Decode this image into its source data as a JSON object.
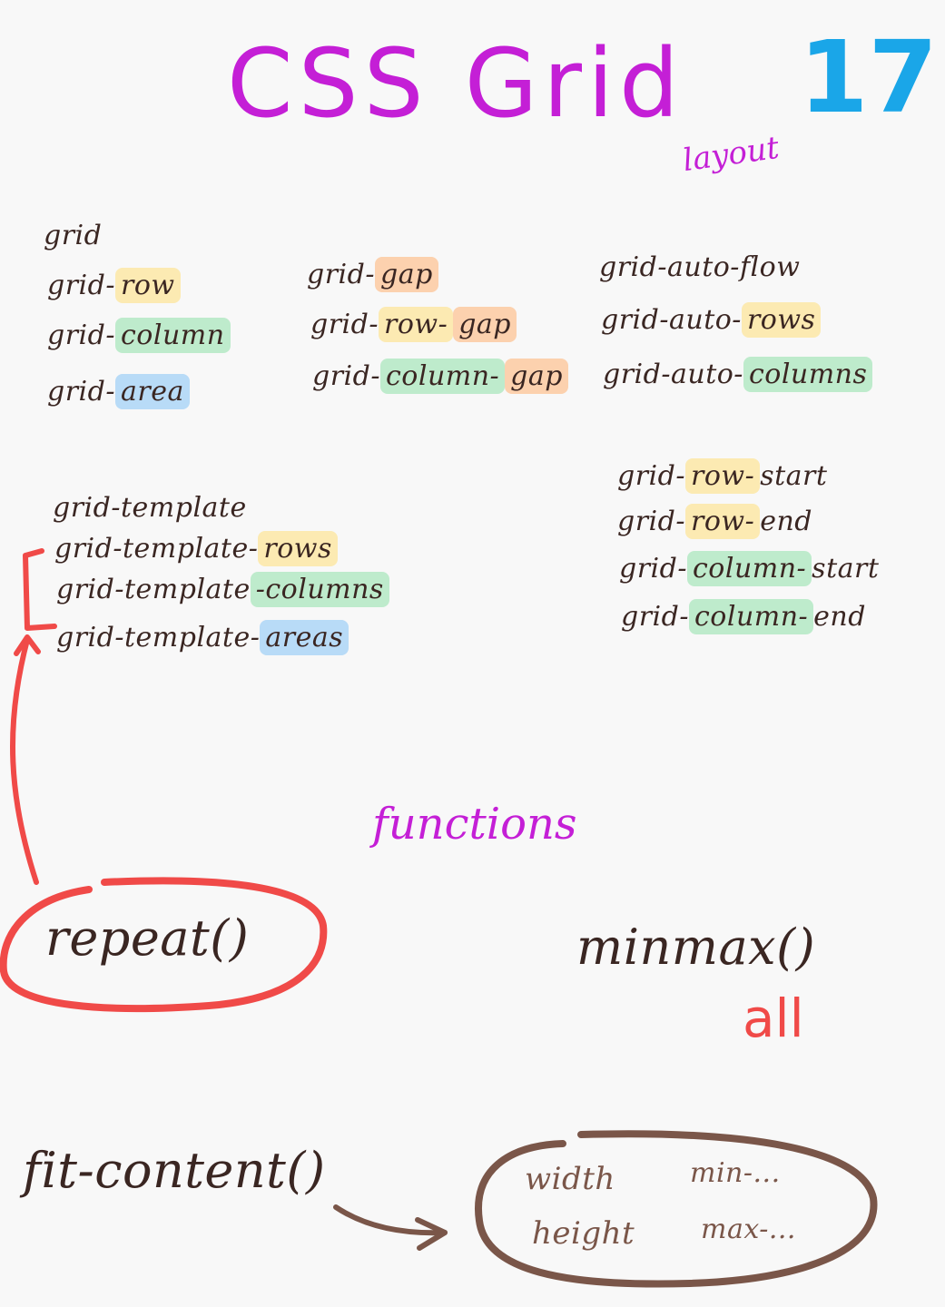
{
  "title": {
    "main": "CSS Grid",
    "number": "17",
    "subtitle": "layout"
  },
  "properties": {
    "col1": [
      "grid",
      "grid-",
      "row",
      "grid-",
      "column",
      "grid-",
      "area"
    ],
    "grid": "grid",
    "grid_row": {
      "prefix": "grid-",
      "hl": "row"
    },
    "grid_column": {
      "prefix": "grid-",
      "hl": "column"
    },
    "grid_area": {
      "prefix": "grid-",
      "hl": "area"
    },
    "gap": {
      "prefix": "grid-",
      "hl": "gap"
    },
    "row_gap": {
      "prefix": "grid-",
      "hl1": "row-",
      "hl2": "gap"
    },
    "column_gap": {
      "prefix": "grid-",
      "hl1": "column-",
      "hl2": "gap"
    },
    "auto_flow": "grid-auto-flow",
    "auto_rows": {
      "prefix": "grid-auto-",
      "hl": "rows"
    },
    "auto_columns": {
      "prefix": "grid-auto-",
      "hl": "columns"
    },
    "template": "grid-template",
    "template_rows": {
      "prefix": "grid-template-",
      "hl": "rows"
    },
    "template_columns": {
      "prefix": "grid-template",
      "hl": "-columns"
    },
    "template_areas": {
      "prefix": "grid-template-",
      "hl": "areas"
    },
    "row_start": {
      "prefix": "grid-",
      "hl": "row-",
      "suffix": "start"
    },
    "row_end": {
      "prefix": "grid-",
      "hl": "row-",
      "suffix": "end"
    },
    "column_start": {
      "prefix": "grid-",
      "hl": "column-",
      "suffix": "start"
    },
    "column_end": {
      "prefix": "grid-",
      "hl": "column-",
      "suffix": "end"
    }
  },
  "functions": {
    "label": "functions",
    "repeat": "repeat()",
    "minmax": "minmax()",
    "minmax_note": "all",
    "fit_content": "fit-content()",
    "fit_targets": {
      "width": "width",
      "height": "height",
      "min": "min-...",
      "max": "max-..."
    }
  },
  "colors": {
    "title": "#c41fd6",
    "number": "#1aa6e8",
    "ink": "#3a2622",
    "red": "#f04a48",
    "brown": "#7a5649"
  }
}
